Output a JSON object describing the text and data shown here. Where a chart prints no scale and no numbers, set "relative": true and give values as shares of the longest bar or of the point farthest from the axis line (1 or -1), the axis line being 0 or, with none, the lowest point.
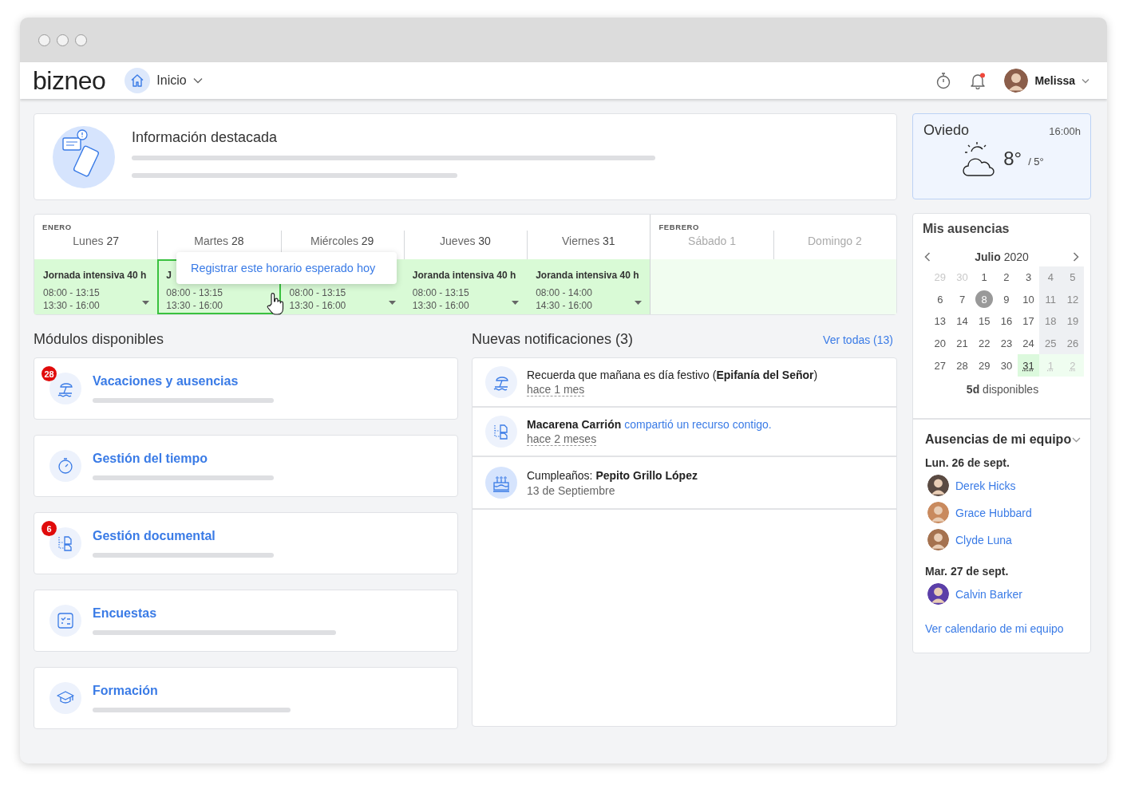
{
  "header": {
    "logo": "bizneo",
    "nav": {
      "label": "Inicio"
    },
    "alerts": true,
    "user": {
      "name": "Melissa"
    }
  },
  "featured": {
    "title": "Información destacada"
  },
  "week": {
    "tooltip": "Registrar este horario esperado hoy",
    "days": [
      {
        "month": "ENERO",
        "day": "Lunes",
        "num": "27",
        "weekend": false,
        "selected": false,
        "menu": true,
        "shift": {
          "title": "Jornada intensiva 40 h",
          "times": [
            "08:00 - 13:15",
            "13:30 - 16:00"
          ]
        }
      },
      {
        "day": "Martes",
        "num": "28",
        "weekend": false,
        "selected": true,
        "menu": false,
        "shift": {
          "title": "J",
          "times": [
            "08:00 - 13:15",
            "13:30 - 16:00"
          ]
        }
      },
      {
        "day": "Miércoles",
        "num": "29",
        "weekend": false,
        "selected": false,
        "menu": true,
        "shift": {
          "times": [
            "08:00 - 13:15",
            "13:30 - 16:00"
          ]
        }
      },
      {
        "day": "Jueves",
        "num": "30",
        "weekend": false,
        "selected": false,
        "menu": true,
        "shift": {
          "title": "Joranda intensiva 40 h",
          "times": [
            "08:00 - 13:15",
            "13:30 - 16:00"
          ]
        }
      },
      {
        "day": "Viernes",
        "num": "31",
        "weekend": false,
        "selected": false,
        "menu": true,
        "shift": {
          "title": "Joranda intensiva 40 h",
          "times": [
            "08:00 - 14:00",
            "14:30 - 16:00"
          ]
        }
      },
      {
        "month": "FEBRERO",
        "day": "Sábado",
        "num": "1",
        "weekend": true,
        "selected": false,
        "menu": false
      },
      {
        "day": "Domingo",
        "num": "2",
        "weekend": true,
        "selected": false,
        "menu": false
      }
    ]
  },
  "modules": {
    "title": "Módulos disponibles",
    "items": [
      {
        "kind": "vacation",
        "label": "Vacaciones y ausencias",
        "badge": "28"
      },
      {
        "kind": "time",
        "label": "Gestión del tiempo"
      },
      {
        "kind": "documents",
        "label": "Gestión documental",
        "badge": "6"
      },
      {
        "kind": "surveys",
        "label": "Encuestas"
      },
      {
        "kind": "training",
        "label": "Formación"
      }
    ]
  },
  "notifications": {
    "title": "Nuevas notificaciones (3)",
    "link": "Ver todas (13)",
    "items": [
      {
        "kind": "holiday",
        "text": "Recuerda que mañana es día festivo (**Epifanía del Señor**)",
        "time": "hace 1 mes",
        "relative": true
      },
      {
        "kind": "document",
        "text": "**Macarena Carrión**",
        "link": "compartió un recurso contigo.",
        "time": "hace 2 meses",
        "relative": true
      },
      {
        "kind": "birthday",
        "text": "Cumpleaños: **Pepito Grillo López**",
        "time": "13 de Septiembre",
        "relative": false
      }
    ]
  },
  "weather": {
    "city": "Oviedo",
    "time": "16:00h",
    "high": "8°",
    "low": "/ 5°"
  },
  "absences": {
    "title": "Mis ausencias",
    "month": "Julio",
    "year": "2020",
    "summary": "**5d** disponibles",
    "weeks": [
      [
        {
          "d": "29",
          "muted": true,
          "weekend": false,
          "selected": false,
          "absence": false
        },
        {
          "d": "30",
          "muted": true,
          "weekend": false,
          "selected": false,
          "absence": false
        },
        {
          "d": "1",
          "muted": false,
          "weekend": false,
          "selected": false,
          "absence": false
        },
        {
          "d": "2",
          "muted": false,
          "weekend": false,
          "selected": false,
          "absence": false
        },
        {
          "d": "3",
          "muted": false,
          "weekend": false,
          "selected": false,
          "absence": false
        },
        {
          "d": "4",
          "muted": false,
          "weekend": true,
          "selected": false,
          "absence": false
        },
        {
          "d": "5",
          "muted": false,
          "weekend": true,
          "selected": false,
          "absence": false
        }
      ],
      [
        {
          "d": "6",
          "muted": false,
          "weekend": false,
          "selected": false,
          "absence": false
        },
        {
          "d": "7",
          "muted": false,
          "weekend": false,
          "selected": false,
          "absence": false
        },
        {
          "d": "8",
          "muted": false,
          "weekend": false,
          "selected": true,
          "absence": false
        },
        {
          "d": "9",
          "muted": false,
          "weekend": false,
          "selected": false,
          "absence": false
        },
        {
          "d": "10",
          "muted": false,
          "weekend": false,
          "selected": false,
          "absence": false
        },
        {
          "d": "11",
          "muted": false,
          "weekend": true,
          "selected": false,
          "absence": false
        },
        {
          "d": "12",
          "muted": false,
          "weekend": true,
          "selected": false,
          "absence": false
        }
      ],
      [
        {
          "d": "13",
          "muted": false,
          "weekend": false,
          "selected": false,
          "absence": false
        },
        {
          "d": "14",
          "muted": false,
          "weekend": false,
          "selected": false,
          "absence": false
        },
        {
          "d": "15",
          "muted": false,
          "weekend": false,
          "selected": false,
          "absence": false
        },
        {
          "d": "16",
          "muted": false,
          "weekend": false,
          "selected": false,
          "absence": false
        },
        {
          "d": "17",
          "muted": false,
          "weekend": false,
          "selected": false,
          "absence": false
        },
        {
          "d": "18",
          "muted": false,
          "weekend": true,
          "selected": false,
          "absence": false
        },
        {
          "d": "19",
          "muted": false,
          "weekend": true,
          "selected": false,
          "absence": false
        }
      ],
      [
        {
          "d": "20",
          "muted": false,
          "weekend": false,
          "selected": false,
          "absence": false
        },
        {
          "d": "21",
          "muted": false,
          "weekend": false,
          "selected": false,
          "absence": false
        },
        {
          "d": "22",
          "muted": false,
          "weekend": false,
          "selected": false,
          "absence": false
        },
        {
          "d": "23",
          "muted": false,
          "weekend": false,
          "selected": false,
          "absence": false
        },
        {
          "d": "24",
          "muted": false,
          "weekend": false,
          "selected": false,
          "absence": false
        },
        {
          "d": "25",
          "muted": false,
          "weekend": true,
          "selected": false,
          "absence": false
        },
        {
          "d": "26",
          "muted": false,
          "weekend": true,
          "selected": false,
          "absence": false
        }
      ],
      [
        {
          "d": "27",
          "muted": false,
          "weekend": false,
          "selected": false,
          "absence": false
        },
        {
          "d": "28",
          "muted": false,
          "weekend": false,
          "selected": false,
          "absence": false
        },
        {
          "d": "29",
          "muted": false,
          "weekend": false,
          "selected": false,
          "absence": false
        },
        {
          "d": "30",
          "muted": false,
          "weekend": false,
          "selected": false,
          "absence": false
        },
        {
          "d": "31",
          "muted": false,
          "weekend": false,
          "selected": false,
          "absence": true
        },
        {
          "d": "1",
          "muted": true,
          "weekend": true,
          "selected": false,
          "absence": true
        },
        {
          "d": "2",
          "muted": true,
          "weekend": true,
          "selected": false,
          "absence": true
        }
      ]
    ]
  },
  "team": {
    "title": "Ausencias de mi equipo",
    "groups": [
      {
        "date": "Lun. 26 de sept.",
        "people": [
          "Derek Hicks",
          "Grace Hubbard",
          "Clyde Luna"
        ]
      },
      {
        "date": "Mar. 27 de sept.",
        "people": [
          "Calvin Barker"
        ]
      }
    ],
    "link": "Ver calendario de mi equipo"
  }
}
